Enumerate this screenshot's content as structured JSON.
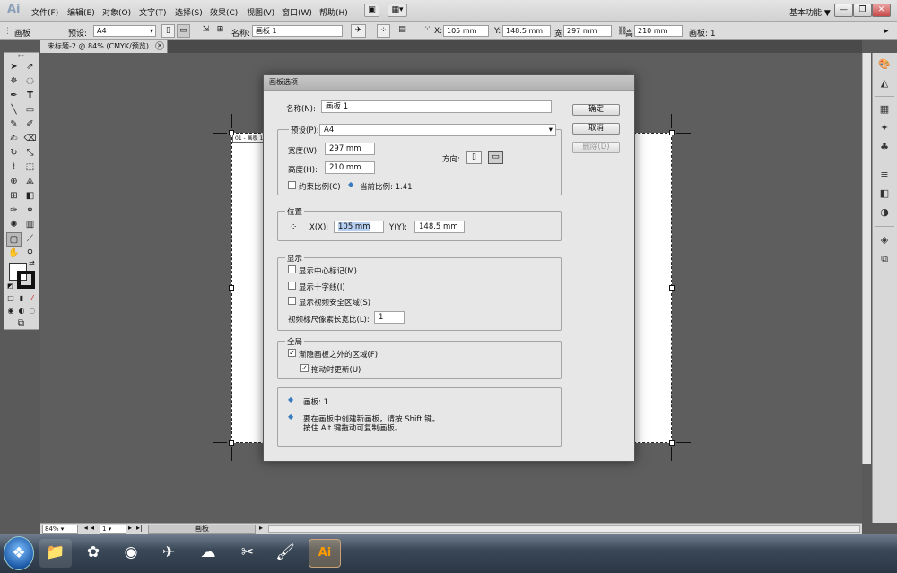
{
  "menubar": {
    "logo": "Ai",
    "items": [
      "文件(F)",
      "编辑(E)",
      "对象(O)",
      "文字(T)",
      "选择(S)",
      "效果(C)",
      "视图(V)",
      "窗口(W)",
      "帮助(H)"
    ],
    "workspace": "基本功能 ▼"
  },
  "controlbar": {
    "panel_label": "画板",
    "preset_label": "预设:",
    "preset_value": "A4",
    "name_label": "名称:",
    "name_value": "画板 1",
    "x_label": "X:",
    "x_value": "105 mm",
    "y_label": "Y:",
    "y_value": "148.5 mm",
    "w_label": "宽",
    "w_value": "297 mm",
    "h_label": "高",
    "h_value": "210 mm",
    "count_label": "画板: 1"
  },
  "document": {
    "tab_title": "未标题-2 @ 84% (CMYK/预览)",
    "artboard_label": "01 - 画板 1"
  },
  "statusbar": {
    "zoom": "84%",
    "page": "1",
    "label": "画板"
  },
  "dialog": {
    "title": "画板选项",
    "name_label": "名称(N):",
    "name_value": "画板 1",
    "preset_label": "预设(P):",
    "preset_value": "A4",
    "width_label": "宽度(W):",
    "width_value": "297 mm",
    "height_label": "高度(H):",
    "height_value": "210 mm",
    "orientation_label": "方向:",
    "constrain_label": "约束比例(C)",
    "ratio_text": "当前比例: 1.41",
    "position": {
      "title": "位置",
      "x_label": "X(X):",
      "x_value": "105 mm",
      "y_label": "Y(Y):",
      "y_value": "148.5 mm"
    },
    "display": {
      "title": "显示",
      "center_mark": "显示中心标记(M)",
      "crosshairs": "显示十字线(I)",
      "video_safe": "显示视频安全区域(S)",
      "ratio_label": "视频标尺像素长宽比(L):",
      "ratio_value": "1"
    },
    "global": {
      "title": "全局",
      "fade": "渐隐画板之外的区域(F)",
      "update": "拖动时更新(U)"
    },
    "info": {
      "count": "画板: 1",
      "line1": "要在画板中创建新画板，请按 Shift 键。",
      "line2": "按住 Alt 键拖动可复制画板。"
    },
    "buttons": {
      "ok": "确定",
      "cancel": "取消",
      "delete": "删除(D)"
    }
  },
  "colors": {
    "accent": "#3a7abf",
    "highlight": "#b7cff0"
  }
}
